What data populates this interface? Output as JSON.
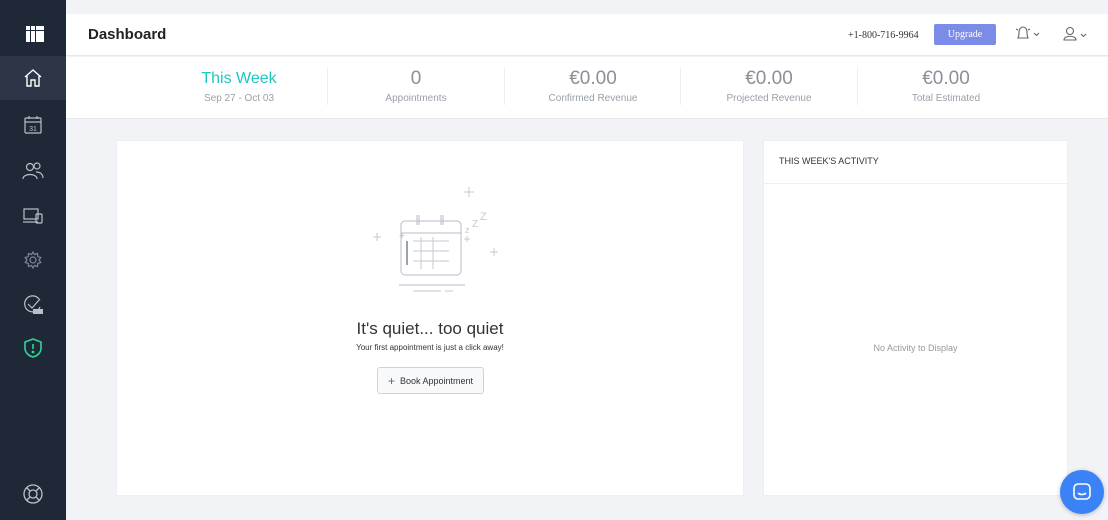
{
  "header": {
    "title": "Dashboard",
    "phone": "+1-800-716-9964",
    "upgrade_label": "Upgrade"
  },
  "sidebar": {
    "items": [
      {
        "icon": "home-icon",
        "active": true
      },
      {
        "icon": "calendar-icon",
        "text": "31"
      },
      {
        "icon": "users-icon"
      },
      {
        "icon": "devices-icon"
      },
      {
        "icon": "settings-icon"
      },
      {
        "icon": "checklist-icon"
      },
      {
        "icon": "shield-icon"
      },
      {
        "icon": "help-icon"
      }
    ]
  },
  "stats": {
    "week_label": "This Week",
    "week_range": "Sep 27 - Oct 03",
    "appointments_value": "0",
    "appointments_label": "Appointments",
    "confirmed_value": "€0.00",
    "confirmed_label": "Confirmed Revenue",
    "projected_value": "€0.00",
    "projected_label": "Projected Revenue",
    "total_value": "€0.00",
    "total_label": "Total Estimated"
  },
  "main_card": {
    "empty_title": "It's quiet... too quiet",
    "empty_subtitle": "Your first appointment is just a click away!",
    "book_label": "Book Appointment"
  },
  "activity": {
    "heading": "THIS WEEK'S ACTIVITY",
    "empty_text": "No Activity to Display"
  },
  "colors": {
    "sidebar_bg": "#1f2836",
    "accent_teal": "#1ec8be",
    "upgrade_bg": "#7b8be8",
    "shield_green": "#2fd49b",
    "chat_blue": "#3b82f6"
  }
}
